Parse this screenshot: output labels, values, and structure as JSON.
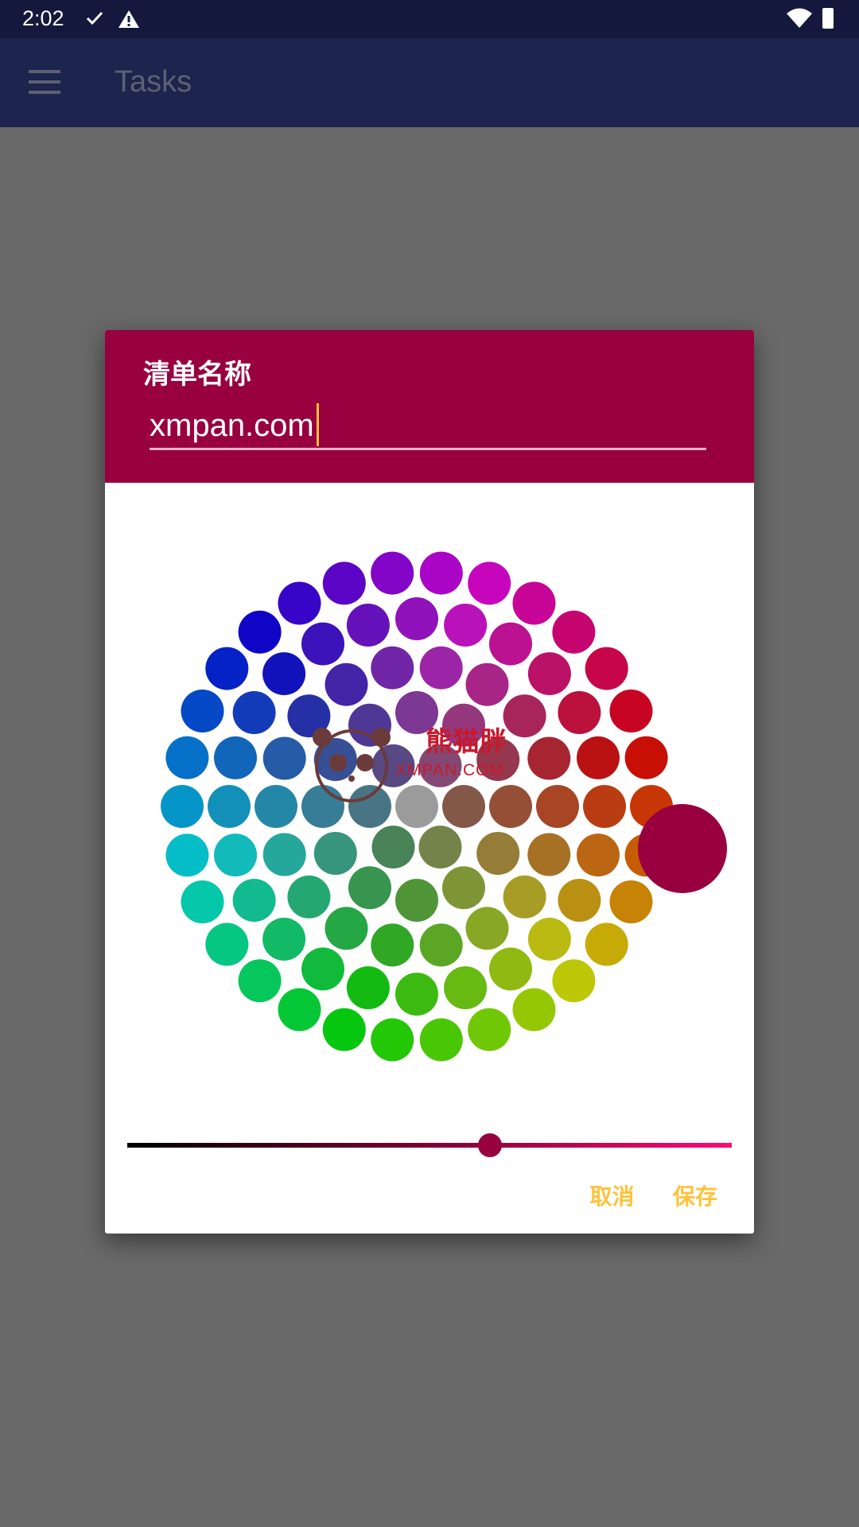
{
  "status_bar": {
    "time": "2:02",
    "icons": [
      "check-icon",
      "alert-icon",
      "wifi-icon",
      "battery-icon"
    ]
  },
  "app_bar": {
    "title": "Tasks",
    "menu_icon": "menu-icon"
  },
  "dialog": {
    "label": "清单名称",
    "name_value": "xmpan.com",
    "header_color": "#98003f",
    "selected_color": "#98003f",
    "slider_value_fraction": 0.6,
    "cancel_label": "取消",
    "save_label": "保存",
    "accent_color": "#ffc23a"
  },
  "watermark": {
    "text_cn": "熊猫胖",
    "text_en": "XMPAN.COM"
  }
}
